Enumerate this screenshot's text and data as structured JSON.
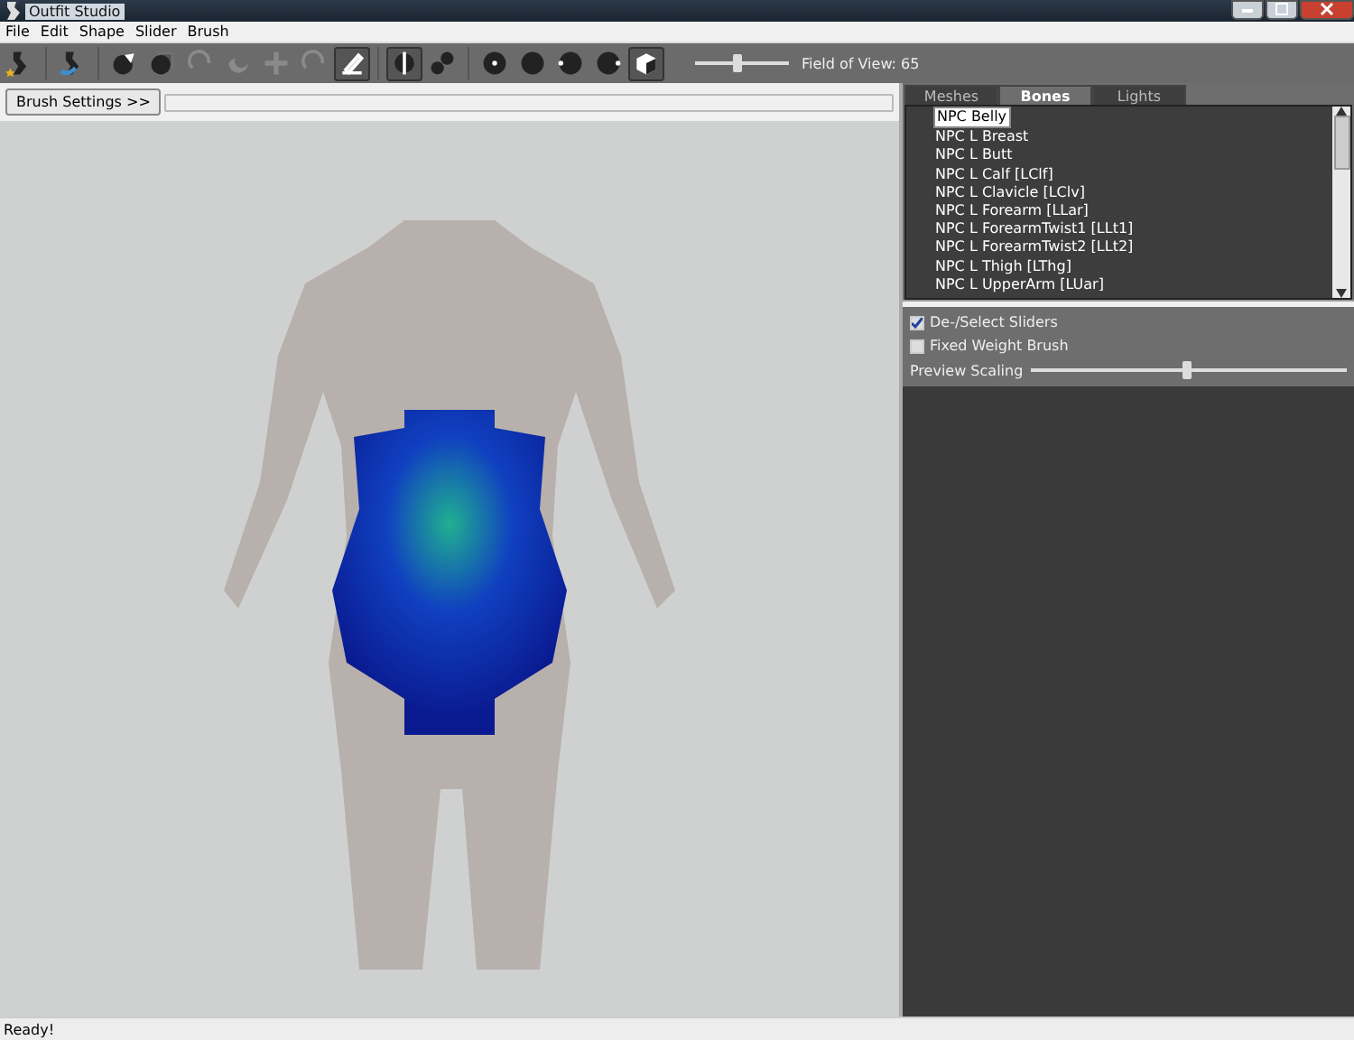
{
  "window": {
    "title": "Outfit Studio"
  },
  "menu": [
    "File",
    "Edit",
    "Shape",
    "Slider",
    "Brush"
  ],
  "toolbar": [
    {
      "kind": "figure-star",
      "pressed": false
    },
    {
      "kind": "separator"
    },
    {
      "kind": "figure-arrow",
      "pressed": false
    },
    {
      "kind": "separator"
    },
    {
      "kind": "ball-arrow",
      "pressed": false
    },
    {
      "kind": "ball-square",
      "pressed": false
    },
    {
      "kind": "ring-dim",
      "pressed": false
    },
    {
      "kind": "moon-dim",
      "pressed": false
    },
    {
      "kind": "cross-dim",
      "pressed": false
    },
    {
      "kind": "ring-dim",
      "pressed": false
    },
    {
      "kind": "brush",
      "pressed": true
    },
    {
      "kind": "separator"
    },
    {
      "kind": "mirror",
      "pressed": true
    },
    {
      "kind": "dots",
      "pressed": false
    },
    {
      "kind": "separator"
    },
    {
      "kind": "ball-dot",
      "pressed": false
    },
    {
      "kind": "ball",
      "pressed": false
    },
    {
      "kind": "ball-left",
      "pressed": false
    },
    {
      "kind": "ball-right",
      "pressed": false
    },
    {
      "kind": "cube",
      "pressed": true
    }
  ],
  "fov": {
    "level": 0.45,
    "label": "Field of View: 65"
  },
  "brush_settings": "Brush Settings >>",
  "tabs": [
    {
      "label": "Meshes",
      "selected": false
    },
    {
      "label": "Bones",
      "selected": true
    },
    {
      "label": "Lights",
      "selected": false
    }
  ],
  "bones": [
    {
      "label": "NPC Belly",
      "selected": true
    },
    {
      "label": "NPC L Breast",
      "selected": false
    },
    {
      "label": "NPC L Butt",
      "selected": false
    },
    {
      "label": "NPC L Calf [LClf]",
      "selected": false
    },
    {
      "label": "NPC L Clavicle [LClv]",
      "selected": false
    },
    {
      "label": "NPC L Forearm [LLar]",
      "selected": false
    },
    {
      "label": "NPC L ForearmTwist1 [LLt1]",
      "selected": false
    },
    {
      "label": "NPC L ForearmTwist2 [LLt2]",
      "selected": false
    },
    {
      "label": "NPC L Thigh [LThg]",
      "selected": false
    },
    {
      "label": "NPC L UpperArm [LUar]",
      "selected": false
    }
  ],
  "options": [
    {
      "label": "De-/Select Sliders",
      "checked": true
    },
    {
      "label": "Fixed Weight Brush",
      "checked": false
    }
  ],
  "preview_scaling": {
    "label": "Preview Scaling",
    "level": 0.49
  },
  "status_bar": "Ready!"
}
